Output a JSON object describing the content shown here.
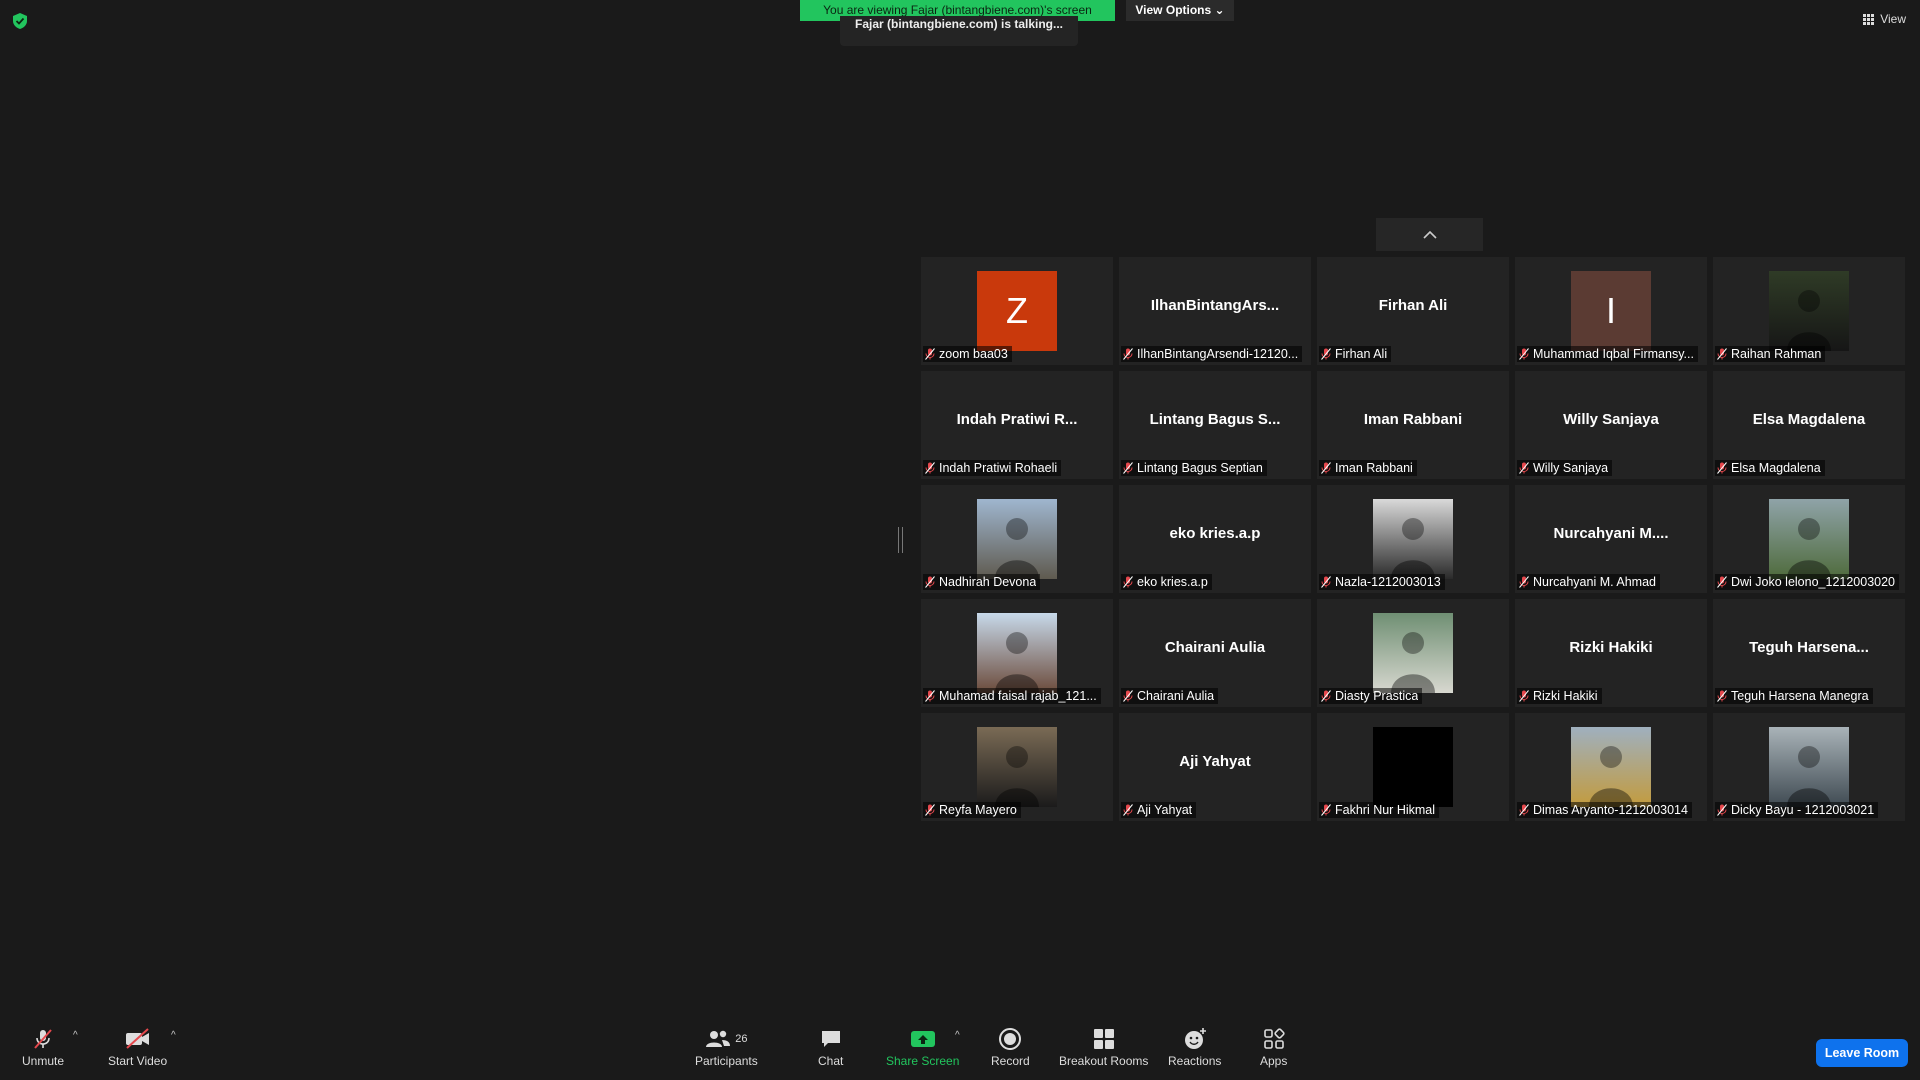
{
  "banner": {
    "viewing_text": "You are viewing Fajar (bintangbiene.com)'s screen",
    "view_options": "View Options",
    "talking_text": "Fajar (bintangbiene.com) is talking..."
  },
  "view_button": {
    "label": "View"
  },
  "gallery": {
    "tiles": [
      {
        "display": "Z",
        "name": "zoom baa03",
        "avatar_type": "letter",
        "avatar_color": "#c9390c"
      },
      {
        "display": "IlhanBintangArs...",
        "name": "IlhanBintangArsendi-12120...",
        "avatar_type": "name"
      },
      {
        "display": "Firhan Ali",
        "name": "Firhan Ali",
        "avatar_type": "name"
      },
      {
        "display": "I",
        "name": "Muhammad Iqbal Firmansy...",
        "avatar_type": "letter",
        "avatar_color": "#5b3b33"
      },
      {
        "display": "",
        "name": "Raihan Rahman",
        "avatar_type": "photo",
        "photo_colors": [
          "#2f3b26",
          "#161616"
        ]
      },
      {
        "display": "Indah Pratiwi R...",
        "name": "Indah Pratiwi Rohaeli",
        "avatar_type": "name"
      },
      {
        "display": "Lintang Bagus S...",
        "name": "Lintang Bagus Septian",
        "avatar_type": "name"
      },
      {
        "display": "Iman Rabbani",
        "name": "Iman Rabbani",
        "avatar_type": "name"
      },
      {
        "display": "Willy Sanjaya",
        "name": "Willy Sanjaya",
        "avatar_type": "name"
      },
      {
        "display": "Elsa Magdalena",
        "name": "Elsa Magdalena",
        "avatar_type": "name"
      },
      {
        "display": "",
        "name": "Nadhirah Devona",
        "avatar_type": "photo",
        "photo_colors": [
          "#9fb6cf",
          "#5f5a4f"
        ]
      },
      {
        "display": "eko kries.a.p",
        "name": "eko kries.a.p",
        "avatar_type": "name"
      },
      {
        "display": "",
        "name": "Nazla-1212003013",
        "avatar_type": "photo",
        "photo_colors": [
          "#d9d9d9",
          "#2a2a2a"
        ]
      },
      {
        "display": "Nurcahyani  M....",
        "name": "Nurcahyani M. Ahmad",
        "avatar_type": "name"
      },
      {
        "display": "",
        "name": "Dwi Joko lelono_1212003020",
        "avatar_type": "photo",
        "photo_colors": [
          "#8fa3a8",
          "#4f6b3c"
        ]
      },
      {
        "display": "",
        "name": "Muhamad faisal rajab_121...",
        "avatar_type": "photo",
        "photo_colors": [
          "#c7d9ea",
          "#6b4a3a"
        ]
      },
      {
        "display": "Chairani Aulia",
        "name": "Chairani Aulia",
        "avatar_type": "name"
      },
      {
        "display": "",
        "name": "Diasty Prastica",
        "avatar_type": "photo",
        "photo_colors": [
          "#6f8f73",
          "#d8d8d0"
        ]
      },
      {
        "display": "Rizki Hakiki",
        "name": "Rizki Hakiki",
        "avatar_type": "name"
      },
      {
        "display": "Teguh  Harsena...",
        "name": "Teguh Harsena Manegra",
        "avatar_type": "name"
      },
      {
        "display": "",
        "name": "Reyfa Mayero",
        "avatar_type": "photo",
        "photo_colors": [
          "#7a6b55",
          "#1b1b1b"
        ]
      },
      {
        "display": "Aji Yahyat",
        "name": "Aji Yahyat",
        "avatar_type": "name"
      },
      {
        "display": "",
        "name": "Fakhri Nur Hikmal",
        "avatar_type": "photo",
        "photo_colors": [
          "#000000",
          "#000000"
        ]
      },
      {
        "display": "",
        "name": "Dimas Aryanto-1212003014",
        "avatar_type": "photo",
        "photo_colors": [
          "#9fb0bf",
          "#c39b3d"
        ]
      },
      {
        "display": "",
        "name": "Dicky Bayu - 1212003021",
        "avatar_type": "photo",
        "photo_colors": [
          "#a9b3b8",
          "#3f4a52"
        ]
      }
    ]
  },
  "toolbar": {
    "unmute": "Unmute",
    "start_video": "Start Video",
    "participants": "Participants",
    "participants_count": "26",
    "chat": "Chat",
    "share_screen": "Share Screen",
    "record": "Record",
    "breakout_rooms": "Breakout Rooms",
    "reactions": "Reactions",
    "apps": "Apps",
    "leave_room": "Leave Room"
  },
  "colors": {
    "accent_green": "#22c55e",
    "leave_blue": "#0e72ed",
    "muted_red": "#e5484d"
  }
}
